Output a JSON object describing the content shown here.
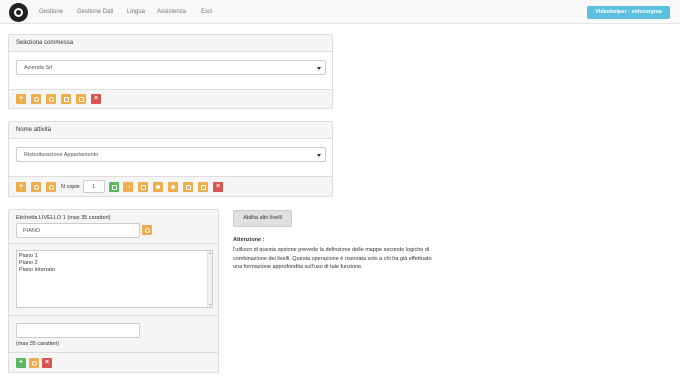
{
  "navbar": {
    "items": [
      "Gestione",
      "Gestione Dati",
      "Lingua",
      "Assistenza",
      "Esci"
    ],
    "user_button": "Videohelper : videosigma"
  },
  "panel1": {
    "title": "Seleziona commessa",
    "select_value": "Azienda Srl"
  },
  "panel2": {
    "title": "Nome attività",
    "select_value": "Ristrutturazione Appartamento",
    "copies_label": "N copie",
    "copies_value": "1"
  },
  "panel3": {
    "level_label": "Etichetta LIVELLO 1 (max 35 caratteri)",
    "level_value": "PIANO",
    "list_items": [
      "Piano 1",
      "Piano 2",
      "Piano Interrato"
    ],
    "new_item_value": "",
    "max_hint": "(max 35 caratteri)"
  },
  "side": {
    "enable_button": "Abilita altri livelli",
    "attention_title": "Attenzione :",
    "attention_lines": [
      "l'utilizzo di questa opzione prevede la definzione delle mappe secondo logiche di",
      "combinazione dei livelli. Questa operazione è riservata solo a chi ha già effettuato",
      "una formazione approfondita sull'uso di tale funzione."
    ]
  },
  "colors": {
    "orange": "#f0ad4e",
    "green": "#5cb85c",
    "red": "#d9534f",
    "info": "#5bc0de"
  }
}
